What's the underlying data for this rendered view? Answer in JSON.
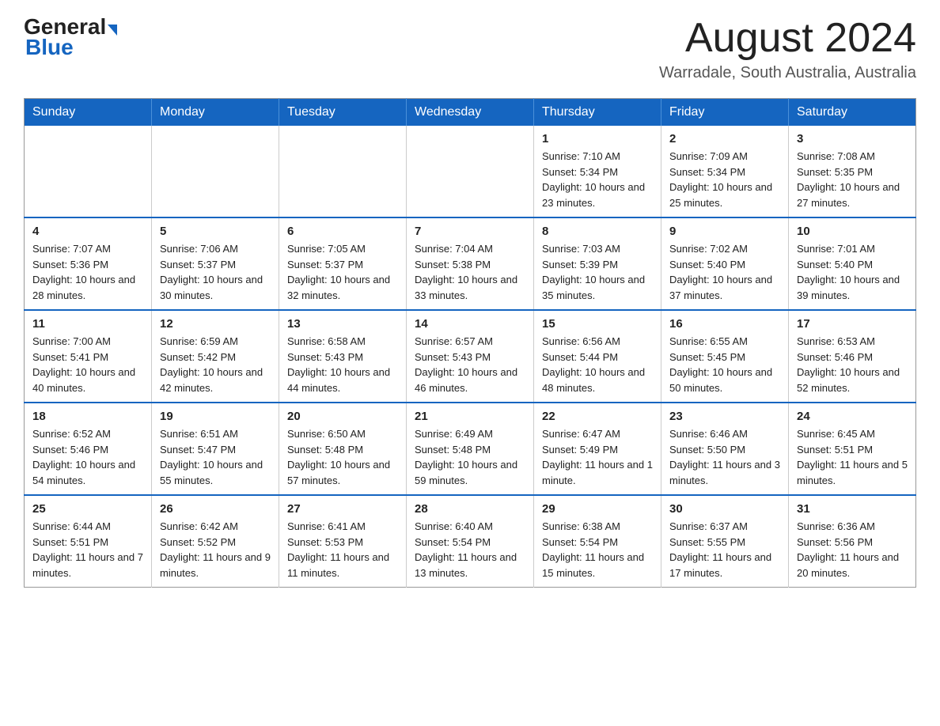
{
  "header": {
    "logo": {
      "general": "General",
      "blue": "Blue",
      "arrow_label": "logo-arrow"
    },
    "title": "August 2024",
    "location": "Warradale, South Australia, Australia"
  },
  "calendar": {
    "days_of_week": [
      "Sunday",
      "Monday",
      "Tuesday",
      "Wednesday",
      "Thursday",
      "Friday",
      "Saturday"
    ],
    "weeks": [
      [
        {
          "day": "",
          "info": ""
        },
        {
          "day": "",
          "info": ""
        },
        {
          "day": "",
          "info": ""
        },
        {
          "day": "",
          "info": ""
        },
        {
          "day": "1",
          "info": "Sunrise: 7:10 AM\nSunset: 5:34 PM\nDaylight: 10 hours and 23 minutes."
        },
        {
          "day": "2",
          "info": "Sunrise: 7:09 AM\nSunset: 5:34 PM\nDaylight: 10 hours and 25 minutes."
        },
        {
          "day": "3",
          "info": "Sunrise: 7:08 AM\nSunset: 5:35 PM\nDaylight: 10 hours and 27 minutes."
        }
      ],
      [
        {
          "day": "4",
          "info": "Sunrise: 7:07 AM\nSunset: 5:36 PM\nDaylight: 10 hours and 28 minutes."
        },
        {
          "day": "5",
          "info": "Sunrise: 7:06 AM\nSunset: 5:37 PM\nDaylight: 10 hours and 30 minutes."
        },
        {
          "day": "6",
          "info": "Sunrise: 7:05 AM\nSunset: 5:37 PM\nDaylight: 10 hours and 32 minutes."
        },
        {
          "day": "7",
          "info": "Sunrise: 7:04 AM\nSunset: 5:38 PM\nDaylight: 10 hours and 33 minutes."
        },
        {
          "day": "8",
          "info": "Sunrise: 7:03 AM\nSunset: 5:39 PM\nDaylight: 10 hours and 35 minutes."
        },
        {
          "day": "9",
          "info": "Sunrise: 7:02 AM\nSunset: 5:40 PM\nDaylight: 10 hours and 37 minutes."
        },
        {
          "day": "10",
          "info": "Sunrise: 7:01 AM\nSunset: 5:40 PM\nDaylight: 10 hours and 39 minutes."
        }
      ],
      [
        {
          "day": "11",
          "info": "Sunrise: 7:00 AM\nSunset: 5:41 PM\nDaylight: 10 hours and 40 minutes."
        },
        {
          "day": "12",
          "info": "Sunrise: 6:59 AM\nSunset: 5:42 PM\nDaylight: 10 hours and 42 minutes."
        },
        {
          "day": "13",
          "info": "Sunrise: 6:58 AM\nSunset: 5:43 PM\nDaylight: 10 hours and 44 minutes."
        },
        {
          "day": "14",
          "info": "Sunrise: 6:57 AM\nSunset: 5:43 PM\nDaylight: 10 hours and 46 minutes."
        },
        {
          "day": "15",
          "info": "Sunrise: 6:56 AM\nSunset: 5:44 PM\nDaylight: 10 hours and 48 minutes."
        },
        {
          "day": "16",
          "info": "Sunrise: 6:55 AM\nSunset: 5:45 PM\nDaylight: 10 hours and 50 minutes."
        },
        {
          "day": "17",
          "info": "Sunrise: 6:53 AM\nSunset: 5:46 PM\nDaylight: 10 hours and 52 minutes."
        }
      ],
      [
        {
          "day": "18",
          "info": "Sunrise: 6:52 AM\nSunset: 5:46 PM\nDaylight: 10 hours and 54 minutes."
        },
        {
          "day": "19",
          "info": "Sunrise: 6:51 AM\nSunset: 5:47 PM\nDaylight: 10 hours and 55 minutes."
        },
        {
          "day": "20",
          "info": "Sunrise: 6:50 AM\nSunset: 5:48 PM\nDaylight: 10 hours and 57 minutes."
        },
        {
          "day": "21",
          "info": "Sunrise: 6:49 AM\nSunset: 5:48 PM\nDaylight: 10 hours and 59 minutes."
        },
        {
          "day": "22",
          "info": "Sunrise: 6:47 AM\nSunset: 5:49 PM\nDaylight: 11 hours and 1 minute."
        },
        {
          "day": "23",
          "info": "Sunrise: 6:46 AM\nSunset: 5:50 PM\nDaylight: 11 hours and 3 minutes."
        },
        {
          "day": "24",
          "info": "Sunrise: 6:45 AM\nSunset: 5:51 PM\nDaylight: 11 hours and 5 minutes."
        }
      ],
      [
        {
          "day": "25",
          "info": "Sunrise: 6:44 AM\nSunset: 5:51 PM\nDaylight: 11 hours and 7 minutes."
        },
        {
          "day": "26",
          "info": "Sunrise: 6:42 AM\nSunset: 5:52 PM\nDaylight: 11 hours and 9 minutes."
        },
        {
          "day": "27",
          "info": "Sunrise: 6:41 AM\nSunset: 5:53 PM\nDaylight: 11 hours and 11 minutes."
        },
        {
          "day": "28",
          "info": "Sunrise: 6:40 AM\nSunset: 5:54 PM\nDaylight: 11 hours and 13 minutes."
        },
        {
          "day": "29",
          "info": "Sunrise: 6:38 AM\nSunset: 5:54 PM\nDaylight: 11 hours and 15 minutes."
        },
        {
          "day": "30",
          "info": "Sunrise: 6:37 AM\nSunset: 5:55 PM\nDaylight: 11 hours and 17 minutes."
        },
        {
          "day": "31",
          "info": "Sunrise: 6:36 AM\nSunset: 5:56 PM\nDaylight: 11 hours and 20 minutes."
        }
      ]
    ]
  }
}
